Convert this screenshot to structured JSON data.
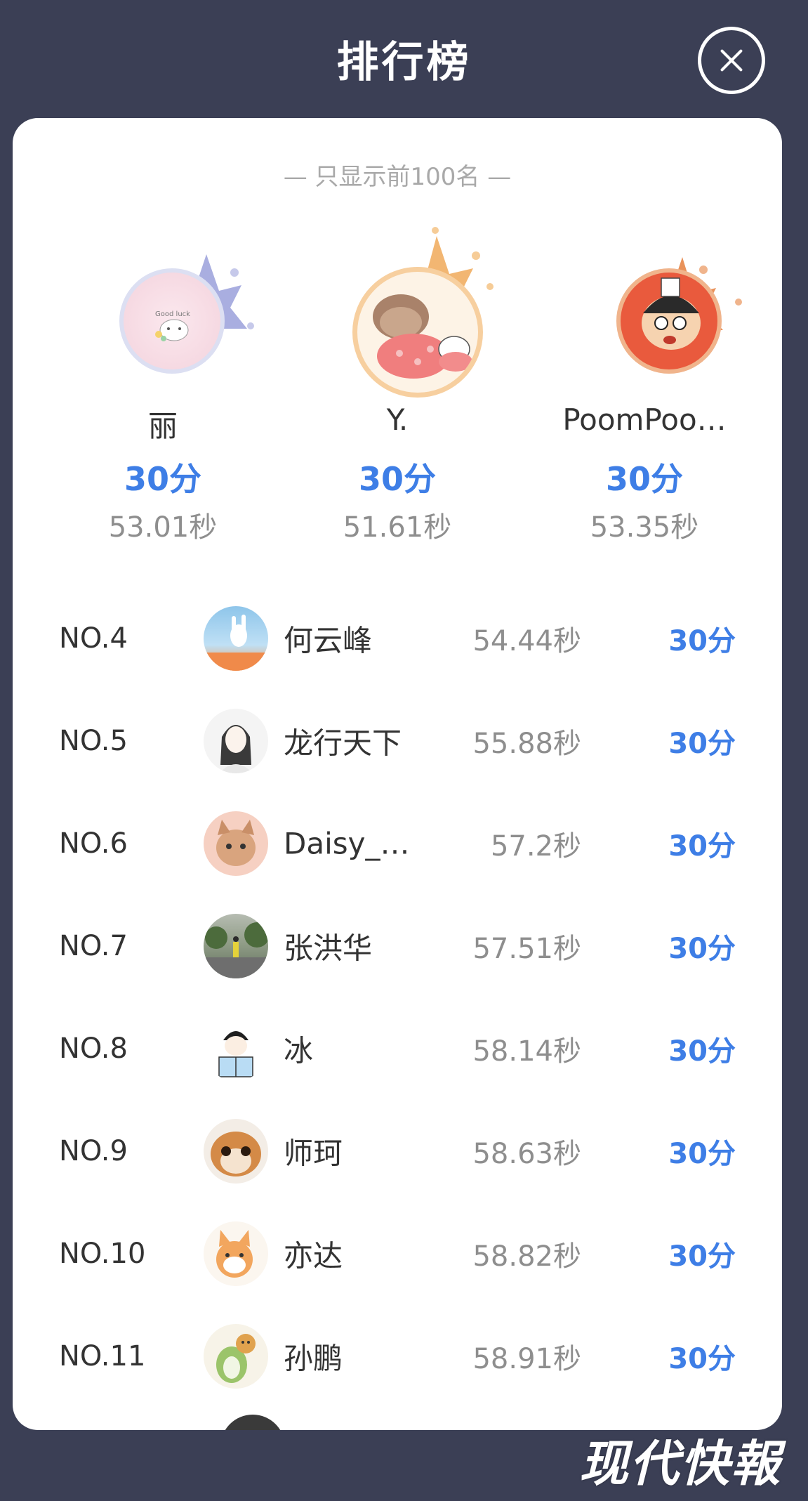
{
  "header": {
    "title": "排行榜",
    "close_icon": "close-icon"
  },
  "leaderboard": {
    "note": "— 只显示前100名 —",
    "podium": [
      {
        "rank": "2",
        "name": "丽",
        "score": "30分",
        "time": "53.01秒",
        "medal_color": "#a9aee0"
      },
      {
        "rank": "1",
        "name": "Y.",
        "score": "30分",
        "time": "51.61秒",
        "medal_color": "#f2b672"
      },
      {
        "rank": "3",
        "name": "PoomPoo…",
        "score": "30分",
        "time": "53.35秒",
        "medal_color": "#e9925a"
      }
    ],
    "rows": [
      {
        "rank": "NO.4",
        "name": "何云峰",
        "time": "54.44秒",
        "score": "30分"
      },
      {
        "rank": "NO.5",
        "name": "龙行天下",
        "time": "55.88秒",
        "score": "30分"
      },
      {
        "rank": "NO.6",
        "name": "Daisy_…",
        "time": "57.2秒",
        "score": "30分"
      },
      {
        "rank": "NO.7",
        "name": "张洪华",
        "time": "57.51秒",
        "score": "30分"
      },
      {
        "rank": "NO.8",
        "name": "冰",
        "time": "58.14秒",
        "score": "30分"
      },
      {
        "rank": "NO.9",
        "name": "师珂",
        "time": "58.63秒",
        "score": "30分"
      },
      {
        "rank": "NO.10",
        "name": "亦达",
        "time": "58.82秒",
        "score": "30分"
      },
      {
        "rank": "NO.11",
        "name": "孙鹏",
        "time": "58.91秒",
        "score": "30分"
      }
    ]
  },
  "watermark": "现代快報",
  "colors": {
    "background": "#3b3f55",
    "accent": "#3e7ee6",
    "gold": "#f2b672",
    "silver": "#a9aee0",
    "bronze": "#e9925a"
  }
}
